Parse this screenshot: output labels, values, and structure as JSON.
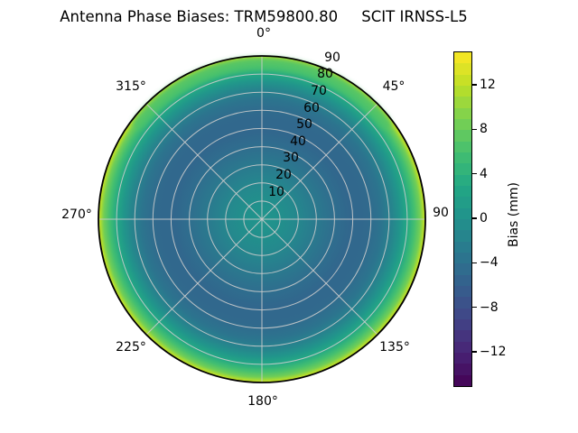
{
  "title": "Antenna Phase Biases: TRM59800.80     SCIT IRNSS-L5",
  "polar": {
    "angular_labels": [
      {
        "label": "0°",
        "deg": 0
      },
      {
        "label": "45°",
        "deg": 45
      },
      {
        "label": "90",
        "deg": 90
      },
      {
        "label": "135°",
        "deg": 135
      },
      {
        "label": "180°",
        "deg": 180
      },
      {
        "label": "225°",
        "deg": 225
      },
      {
        "label": "270°",
        "deg": 270
      },
      {
        "label": "315°",
        "deg": 315
      }
    ],
    "radial_ticks": [
      10,
      20,
      30,
      40,
      50,
      60,
      70,
      80,
      90
    ],
    "grid_color": "#cccccc",
    "outline_color": "#000000"
  },
  "colorbar": {
    "label": "Bias (mm)",
    "tick_values": [
      12,
      8,
      4,
      0,
      -4,
      -8,
      -12
    ],
    "range": [
      -15,
      15
    ],
    "bands": 30,
    "viridis_anchors": [
      "#440154",
      "#482475",
      "#414487",
      "#355f8d",
      "#2a788e",
      "#21918c",
      "#22a884",
      "#44bf70",
      "#7ad151",
      "#bddf26",
      "#fde725"
    ]
  },
  "chart_data": {
    "type": "heatmap",
    "projection": "polar",
    "title": "Antenna Phase Biases: TRM59800.80     SCIT IRNSS-L5",
    "colormap": "viridis",
    "colorbar_label": "Bias (mm)",
    "colorbar_ticks": [
      -12,
      -8,
      -4,
      0,
      4,
      8,
      12
    ],
    "value_range_mm": [
      -15,
      15
    ],
    "angular_ticks_deg": [
      0,
      45,
      90,
      135,
      180,
      225,
      270,
      315
    ],
    "radial_ticks": [
      10,
      20,
      30,
      40,
      50,
      60,
      70,
      80,
      90
    ],
    "radial_axis_max": 90,
    "radial_label_azimuth_deg": 22.5,
    "radial_profile_mm": [
      [
        0,
        0.5
      ],
      [
        8,
        0
      ],
      [
        18,
        -1
      ],
      [
        28,
        -2.5
      ],
      [
        38,
        -4
      ],
      [
        48,
        -5
      ],
      [
        58,
        -4.8
      ],
      [
        66,
        -3.5
      ],
      [
        72,
        -1.5
      ],
      [
        76,
        0.5
      ],
      [
        80,
        3
      ],
      [
        84,
        6
      ],
      [
        87,
        8.5
      ],
      [
        89,
        11.5
      ],
      [
        90,
        13
      ]
    ],
    "rim_bias_by_azimuth_mm": [
      [
        0,
        7.5
      ],
      [
        45,
        11
      ],
      [
        90,
        13
      ],
      [
        135,
        12.5
      ],
      [
        180,
        12.5
      ],
      [
        225,
        13
      ],
      [
        270,
        13.5
      ],
      [
        315,
        11
      ]
    ],
    "notes": "Azimuthally near-symmetric bullseye: teal center ~0 mm, dark blue annulus ~-5 mm near zenith angle 50, bright yellow-green rim ~+13 mm at horizon; rim greener (~+7.5 mm) near azimuth 0°."
  }
}
